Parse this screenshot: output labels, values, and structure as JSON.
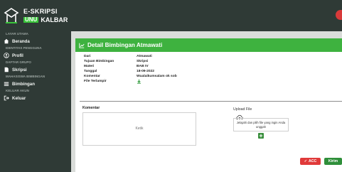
{
  "app": {
    "brand_line1": "E-SKRIPSI",
    "brand_highlight": "UNU",
    "brand_rest": "KALBAR"
  },
  "sidebar": {
    "sections": [
      {
        "title": "LAYAR UTAMA",
        "items": [
          {
            "label": "Beranda",
            "icon": "home-icon"
          }
        ]
      },
      {
        "title": "IDENTITAS PENGGUNA",
        "items": [
          {
            "label": "Profil",
            "icon": "user-icon"
          }
        ]
      },
      {
        "title": "DAFTAR GRUPO",
        "items": [
          {
            "label": "Skripsi",
            "icon": "document-icon"
          }
        ]
      },
      {
        "title": "MAHASISWA BIMBINGAN",
        "items": [
          {
            "label": "Bimbingan",
            "icon": "list-icon"
          }
        ]
      },
      {
        "title": "KELUAR AKUN",
        "items": [
          {
            "label": "Keluar",
            "icon": "logout-icon"
          }
        ]
      }
    ]
  },
  "card": {
    "title": "Detail Bimbingan Atmawati",
    "details": [
      {
        "label": "Dari",
        "value": "Atmawati"
      },
      {
        "label": "Tujuan Bimbingan",
        "value": "Skripsi"
      },
      {
        "label": "Materi",
        "value": "BAB IV"
      },
      {
        "label": "Tanggal",
        "value": "18-09-2022"
      },
      {
        "label": "Komentar",
        "value": "Wualaikumsalam ok sob"
      },
      {
        "label": "File Terlampir",
        "value": ""
      }
    ],
    "komentar_label": "Komentar",
    "komentar_placeholder": "Ketik",
    "upload_label": "Upload File",
    "upload_hint": "Jelajahi dan pilih file yang ingin Anda unggah",
    "acc_button": "ACC",
    "kirim_button": "Kirim"
  },
  "colors": {
    "sidebar_bg": "#2f3a36",
    "accent_green": "#3eb23f",
    "acc_red": "#e03a3a",
    "kirim_green": "#2f8f3a"
  }
}
